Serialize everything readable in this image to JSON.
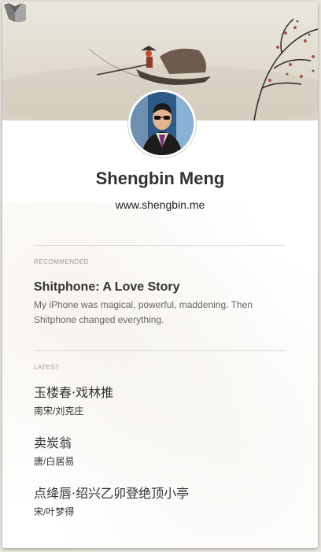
{
  "profile": {
    "name": "Shengbin Meng",
    "website": "www.shengbin.me"
  },
  "icons": {
    "logo": "medium-logo-icon",
    "avatar": "profile-photo"
  },
  "recommended": {
    "label": "RECOMMENDED",
    "title": "Shitphone: A Love Story",
    "description": "My iPhone was magical, powerful, maddening. Then Shitphone changed everything."
  },
  "latest": {
    "label": "LATEST",
    "posts": [
      {
        "title": "玉楼春·戏林推",
        "subtitle": "南宋/刘克庄"
      },
      {
        "title": "卖炭翁",
        "subtitle": "唐/白居易"
      },
      {
        "title": "点绛唇·绍兴乙卯登绝顶小亭",
        "subtitle": "宋/叶梦得"
      }
    ]
  },
  "colors": {
    "text_primary": "#333333",
    "text_secondary": "#666666",
    "label": "#999999",
    "divider": "#d7d7d7"
  }
}
